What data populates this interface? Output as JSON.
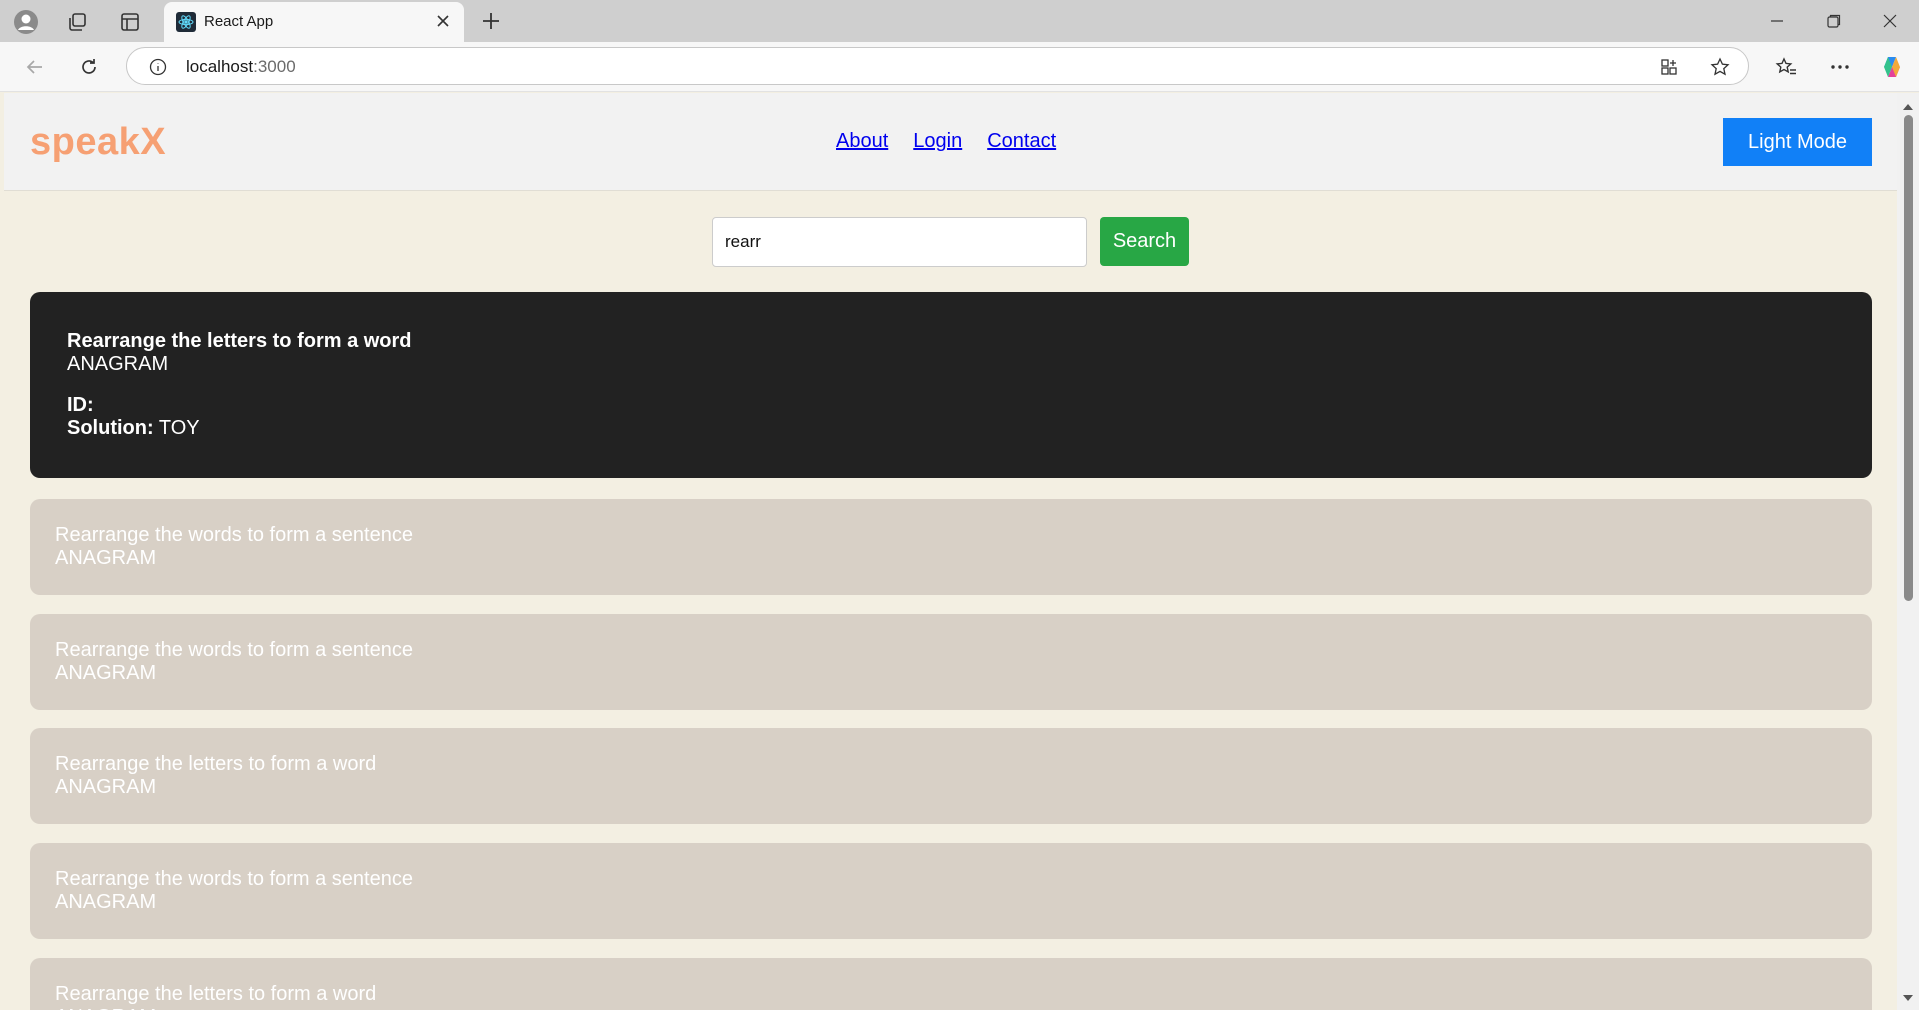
{
  "browser": {
    "tab_title": "React App",
    "url_host": "localhost",
    "url_port": ":3000"
  },
  "site": {
    "logo": "speakX",
    "nav": [
      "About",
      "Login",
      "Contact"
    ],
    "mode_button": "Light Mode"
  },
  "search": {
    "value": "rearr",
    "button": "Search"
  },
  "expanded": {
    "title": "Rearrange the letters to form a word",
    "type": "ANAGRAM",
    "id_label": "ID:",
    "id_value": "",
    "solution_label": "Solution:",
    "solution_value": "TOY"
  },
  "results": [
    {
      "title": "Rearrange the words to form a sentence",
      "type": "ANAGRAM"
    },
    {
      "title": "Rearrange the words to form a sentence",
      "type": "ANAGRAM"
    },
    {
      "title": "Rearrange the letters to form a word",
      "type": "ANAGRAM"
    },
    {
      "title": "Rearrange the words to form a sentence",
      "type": "ANAGRAM"
    },
    {
      "title": "Rearrange the letters to form a word",
      "type": "ANAGRAM"
    }
  ],
  "colors": {
    "logo": "#f6a073",
    "mode_button": "#1180f7",
    "search_button": "#28a745",
    "expanded_card": "#222222",
    "card": "#d8d0c6",
    "page_bg": "#f3efe2"
  },
  "icons": [
    "profile-icon",
    "workspaces-icon",
    "tab-actions-icon",
    "react-favicon",
    "close-icon",
    "plus-icon",
    "minimize-icon",
    "restore-icon",
    "window-close-icon",
    "back-icon",
    "reload-icon",
    "info-icon",
    "app-available-icon",
    "favorite-star-icon",
    "favorites-icon",
    "more-icon",
    "copilot-icon"
  ]
}
